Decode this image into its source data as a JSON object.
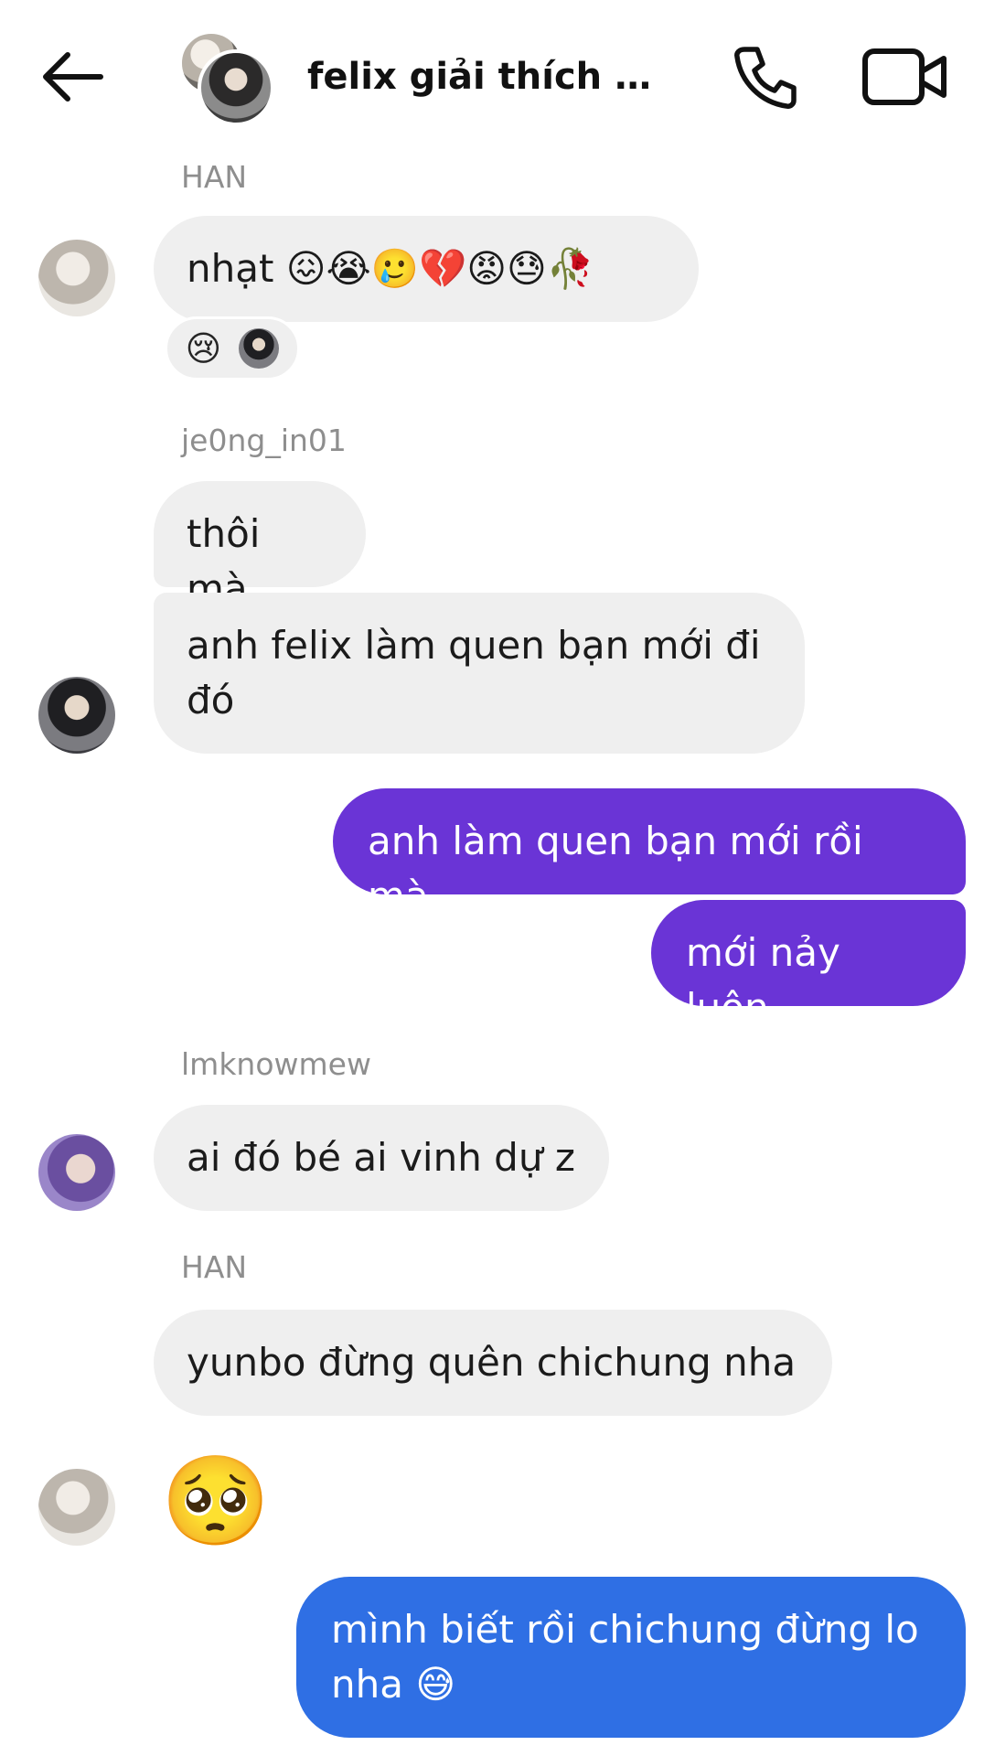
{
  "header": {
    "title": "felix giải thích đi g..."
  },
  "messages": [
    {
      "sender": "HAN",
      "text": "nhạt 😖😭🥲💔😡😓🥀",
      "reaction": "😢"
    },
    {
      "sender": "je0ng_in01",
      "lines": [
        "thôi mà",
        "anh felix làm quen bạn mới đi đó"
      ]
    },
    {
      "outgoing": [
        "anh làm quen bạn mới rồi mà",
        "mới nảy luôn"
      ]
    },
    {
      "sender": "lmknowmew",
      "text": "ai đó bé ai vinh dự z"
    },
    {
      "sender": "HAN",
      "text": "yunbo đừng quên chichung nha",
      "emoji": "🥺"
    },
    {
      "outgoing": [
        "mình biết rồi chichung đừng lo nha 😅"
      ]
    }
  ],
  "colors": {
    "outgoing_purple": "#6a34d6",
    "outgoing_blue": "#2f6fe4",
    "incoming_bg": "#efefef"
  },
  "icons": [
    "back-arrow-icon",
    "phone-icon",
    "video-camera-icon"
  ]
}
